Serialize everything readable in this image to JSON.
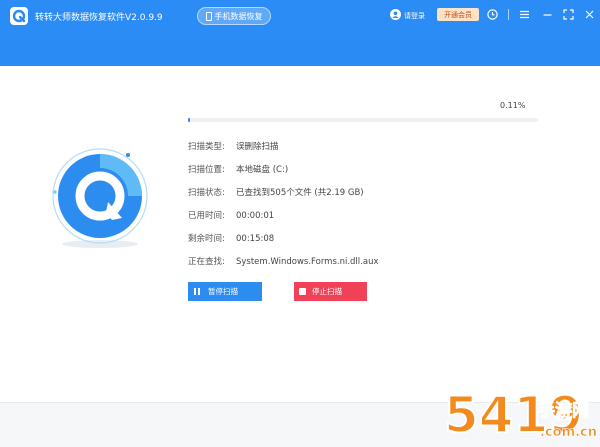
{
  "header": {
    "app_title": "转转大师数据恢复软件V2.0.9.9",
    "mobile_recovery_label": "手机数据恢复",
    "login_label": "请登录",
    "vip_label": "开通会员"
  },
  "scan": {
    "progress_text": "0.11%",
    "progress_fraction": 0.0011,
    "rows": [
      {
        "label": "扫描类型:",
        "value": "误删除扫描"
      },
      {
        "label": "扫描位置:",
        "value": "本地磁盘  (C:)"
      },
      {
        "label": "扫描状态:",
        "value": "已查找到505个文件  (共2.19 GB)"
      },
      {
        "label": "已用时间:",
        "value": "00:00:01"
      },
      {
        "label": "剩余时间:",
        "value": "00:15:08"
      },
      {
        "label": "正在查找:",
        "value": "System.Windows.Forms.ni.dll.aux"
      }
    ],
    "pause_label": "暂停扫描",
    "stop_label": "停止扫描"
  },
  "watermark": {
    "text": "5419",
    "site": "手游网",
    "domain": ".com.cn"
  },
  "colors": {
    "header_blue": "#2a8bf5",
    "primary_button": "#2d8cf0",
    "stop_button": "#f04157",
    "vip_bg": "#fde3c6",
    "watermark_orange": "#f28a1e"
  }
}
